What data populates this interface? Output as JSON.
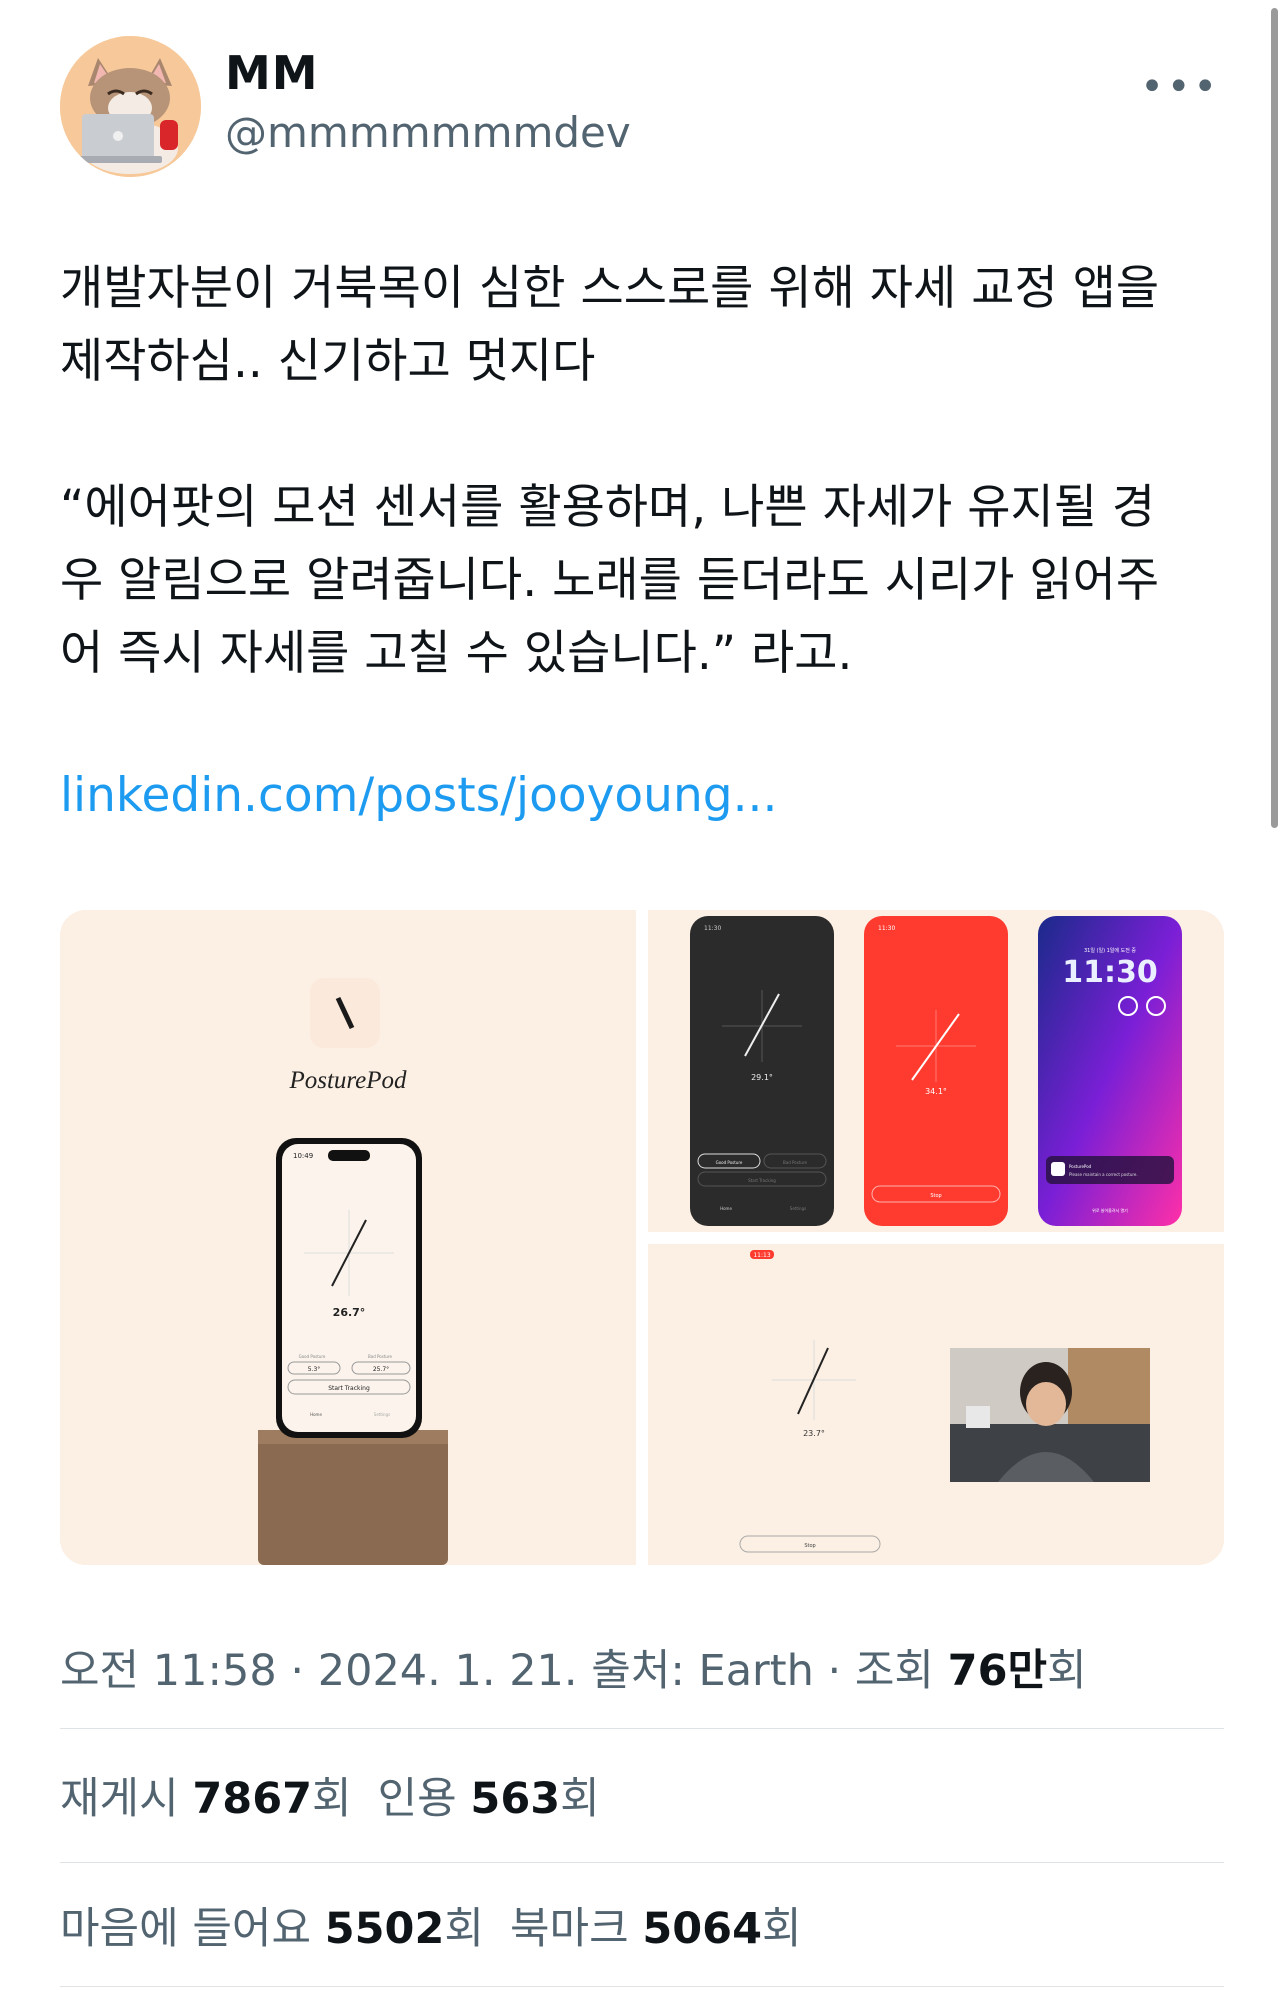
{
  "author": {
    "name": "MM",
    "handle": "@mmmmmmmdev"
  },
  "more_label": "•••",
  "tweet": {
    "text": "개발자분이 거북목이 심한 스스로를 위해 자세 교정 앱을\n제작하심.. 신기하고 멋지다\n\n“에어팟의 모션 센서를 활용하며, 나쁜 자세가 유지될 경\n우 알림으로 알려줍니다. 노래를 듣더라도 시리가 읽어주\n어 즉시 자세를 고칠 수 있습니다.” 라고.",
    "link": "linkedin.com/posts/jooyoung..."
  },
  "media": {
    "brand_name": "PosturePod",
    "phone_main": {
      "clock": "10:49",
      "angle": "26.7°",
      "good_label": "Good Posture",
      "bad_label": "Bad Posture",
      "good_val": "5.3°",
      "bad_val": "25.7°",
      "start_button": "Start Tracking",
      "tab_home": "Home",
      "tab_settings": "Settings"
    },
    "phone_dark": {
      "clock": "11:30",
      "angle": "29.1°",
      "good_button": "Good Posture",
      "bad_button": "Bad Posture",
      "start_button": "Start Tracking",
      "tab_home": "Home",
      "tab_settings": "Settings"
    },
    "phone_red": {
      "clock": "11:30",
      "angle": "34.1°",
      "stop_button": "Stop"
    },
    "phone_lock": {
      "date": "31일 (일) 1일에 도전 중",
      "time": "11:30",
      "notif_title": "PosturePod",
      "notif_body": "Please maintain a correct posture.",
      "footer": "위로 쓸어올려서 열기"
    },
    "desktop": {
      "clock": "11:13",
      "angle": "23.7°",
      "stop_button": "Stop"
    },
    "colors": {
      "cream": "#fcefe3",
      "dark": "#2b2b2b",
      "red": "#ff3b30",
      "lock_purple": "#7a1fd6"
    }
  },
  "meta": {
    "time": "오전 11:58",
    "sep": " · ",
    "date": "2024. 1. 21.",
    "source_label": "출처: Earth",
    "views_label": "조회",
    "views_value": "76만",
    "views_suffix": "회"
  },
  "stats_row1": [
    {
      "label": "재게시",
      "value": "7867",
      "suffix": "회"
    },
    {
      "label": "인용",
      "value": "563",
      "suffix": "회"
    }
  ],
  "stats_row2": [
    {
      "label": "마음에 들어요",
      "value": "5502",
      "suffix": "회"
    },
    {
      "label": "북마크",
      "value": "5064",
      "suffix": "회"
    }
  ]
}
